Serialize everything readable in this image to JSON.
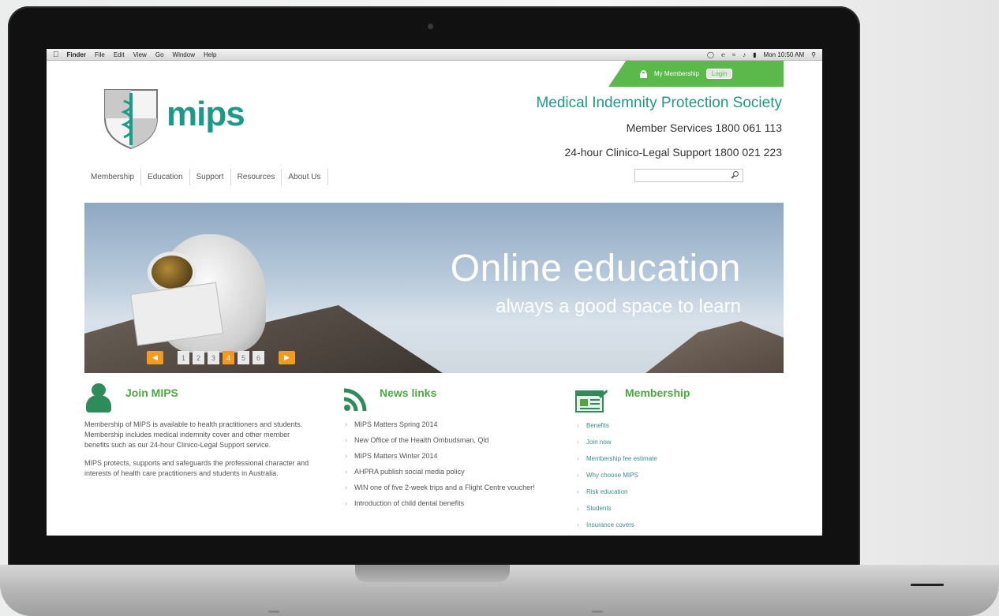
{
  "menubar": {
    "apple_icon": "apple-icon",
    "items": [
      "Finder",
      "File",
      "Edit",
      "View",
      "Go",
      "Window",
      "Help"
    ],
    "clock": "Mon 10:50 AM"
  },
  "header": {
    "membership_label": "My Membership",
    "login_label": "Login",
    "logo_text": "mips",
    "org_name": "Medical Indemnity Protection Society",
    "member_services": "Member Services 1800 061 113",
    "support_line": "24-hour Clinico-Legal Support 1800 021 223",
    "search_placeholder": ""
  },
  "nav": [
    "Membership",
    "Education",
    "Support",
    "Resources",
    "About Us"
  ],
  "hero": {
    "title": "Online education",
    "subtitle": "always a good space to learn",
    "slides": [
      "1",
      "2",
      "3",
      "4",
      "5",
      "6"
    ],
    "active_slide": 4,
    "prev_icon": "chevron-left-icon",
    "next_icon": "chevron-right-icon"
  },
  "join": {
    "heading": "Join MIPS",
    "para1": "Membership of MIPS is available to health practitioners and students. Membership includes medical indemnity cover and other member benefits such as our 24-hour Clinico-Legal Support service.",
    "para2": "MIPS protects, supports and safeguards the professional character and interests of health care practitioners and students in Australia."
  },
  "news": {
    "heading": "News links",
    "items": [
      "MIPS Matters Spring 2014",
      "New Office of the Health Ombudsman, Qld",
      "MIPS Matters Winter 2014",
      "AHPRA publish social media policy",
      "WIN one of five 2-week trips and a Flight Centre voucher!",
      "Introduction of child dental benefits"
    ]
  },
  "membership": {
    "heading": "Membership",
    "items": [
      "Benefits",
      "Join now",
      "Membership fee estimate",
      "Why choose MIPS",
      "Risk education",
      "Students",
      "Insurance covers"
    ]
  },
  "colors": {
    "brand_green": "#5bb84a",
    "brand_teal": "#1a9a87",
    "accent_orange": "#f39a21"
  }
}
